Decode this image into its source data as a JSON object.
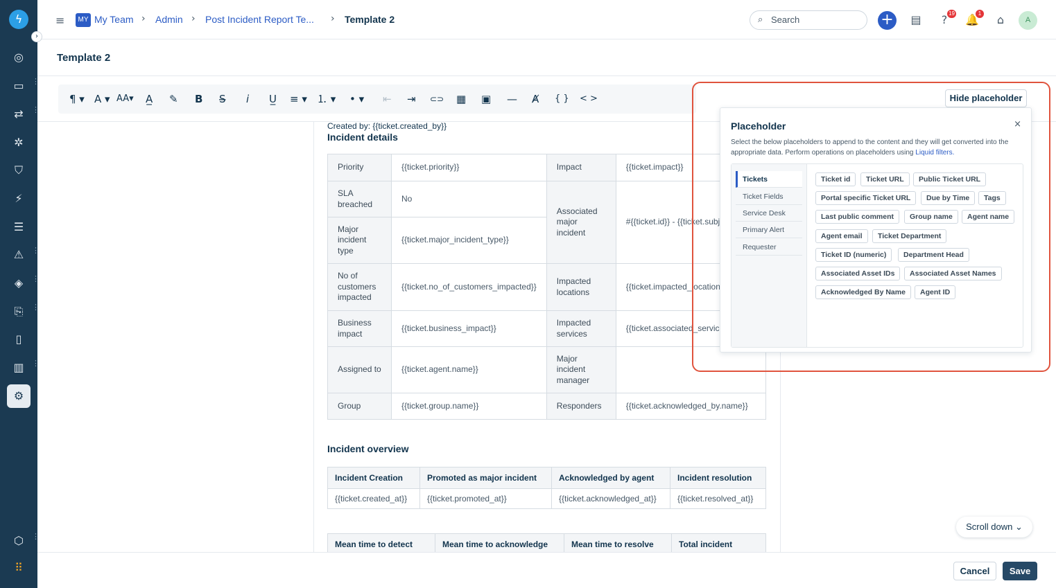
{
  "nav": {
    "logo": "ϟ",
    "expand": "›",
    "items": [
      "◎",
      "▭",
      "⇄",
      "✲",
      "⛉",
      "⚡",
      "☰",
      "⚠",
      "◈",
      "⎘",
      "▯",
      "▥",
      "⚙"
    ],
    "apps": "⠿",
    "cube": "⬡"
  },
  "header": {
    "menu_icon": "≡",
    "team_badge": "MY",
    "breadcrumbs": [
      "My Team",
      "Admin",
      "Post Incident Report Te...",
      "Template 2"
    ],
    "search_placeholder": "Search",
    "search_icon": "⌕",
    "plus": "+",
    "icons": {
      "contacts": "▤",
      "help": "?",
      "bell": "🔔",
      "store": "⌂"
    },
    "help_badge": "19",
    "bell_badge": "1",
    "avatar": "A"
  },
  "page_title": "Template 2",
  "toolbar": {
    "paragraph": "¶ ▾",
    "font": "A ▾",
    "font_size": "AA▾",
    "color": "A̲",
    "highlight": "✎",
    "bold": "B",
    "strike": "S̶",
    "italic": "i",
    "underline": "U̲",
    "align": "≡ ▾",
    "olist": "⒈ ▾",
    "ulist": "• ▾",
    "outdent": "⇤",
    "indent": "⇥",
    "link": "⊂⊃",
    "table": "▦",
    "image": "▣",
    "hr": "—",
    "clear": "Ⱥ",
    "code": "{ }",
    "source": "< >"
  },
  "document": {
    "created_by": "Created by: {{ticket.created_by}}",
    "details_heading": "Incident details",
    "details": {
      "priority_label": "Priority",
      "priority_val": "{{ticket.priority}}",
      "impact_label": "Impact",
      "impact_val": "{{ticket.impact}}",
      "sla_label": "SLA breached",
      "sla_val": "No",
      "assoc_label": "Associated major incident",
      "assoc_val": "#{{ticket.id}} - {{ticket.subje",
      "mit_label": "Major incident type",
      "mit_val": "{{ticket.major_incident_type}}",
      "noc_label": "No of customers impacted",
      "noc_val": "{{ticket.no_of_customers_impacted}}",
      "loc_label": "Impacted locations",
      "loc_val": "{{ticket.impacted_locations",
      "bi_label": "Business impact",
      "bi_val": "{{ticket.business_impact}}",
      "svc_label": "Impacted services",
      "svc_val": "{{ticket.associated_service",
      "assigned_label": "Assigned to",
      "assigned_val": "{{ticket.agent.name}}",
      "mgr_label": "Major incident manager",
      "mgr_val": "",
      "group_label": "Group",
      "group_val": "{{ticket.group.name}}",
      "resp_label": "Responders",
      "resp_val": "{{ticket.acknowledged_by.name}}"
    },
    "overview_heading": "Incident overview",
    "overview_headers": [
      "Incident Creation",
      "Promoted as major incident",
      "Acknowledged by agent",
      "Incident resolution"
    ],
    "overview_values": [
      "{{ticket.created_at}}",
      "{{ticket.promoted_at}}",
      "{{ticket.acknowledged_at}}",
      "{{ticket.resolved_at}}"
    ],
    "metrics_headers": [
      "Mean time to detect",
      "Mean time to acknowledge",
      "Mean time to resolve",
      "Total incident"
    ]
  },
  "placeholder": {
    "hide_button": "Hide placeholder",
    "title": "Placeholder",
    "close": "×",
    "description": "Select the below placeholders to append to the content and they will get converted into the appropriate data. Perform operations on placeholders using",
    "link": "Liquid filters.",
    "tabs": [
      "Tickets",
      "Ticket Fields",
      "Service Desk",
      "Primary Alert",
      "Requester"
    ],
    "chips": [
      "Ticket id",
      "Ticket URL",
      "Public Ticket URL",
      "Portal specific Ticket URL",
      "Due by Time",
      "Tags",
      "Last public comment",
      "Group name",
      "Agent name",
      "Agent email",
      "Ticket Department",
      "Ticket ID (numeric)",
      "Department Head",
      "Associated Asset IDs",
      "Associated Asset Names",
      "Acknowledged By Name",
      "Agent ID"
    ]
  },
  "scroll_down": "Scroll down ⌄",
  "footer": {
    "cancel": "Cancel",
    "save": "Save"
  },
  "colors": {
    "accent": "#2c5cc5",
    "nav_bg": "#1b3a52",
    "highlight": "#e0533d",
    "save": "#264966"
  }
}
